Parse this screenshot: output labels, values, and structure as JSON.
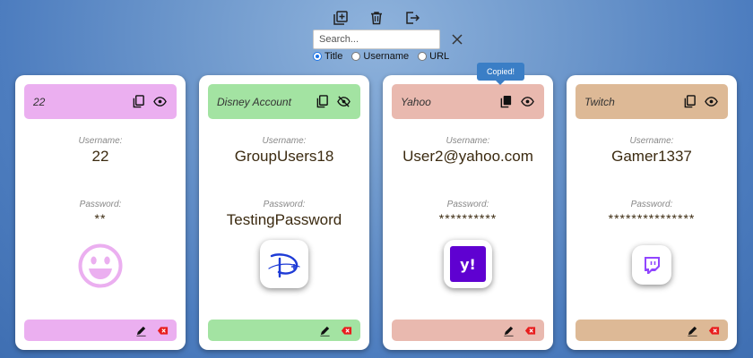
{
  "toolbar": {
    "icons": [
      "add-entry-icon",
      "delete-icon",
      "logout-icon"
    ]
  },
  "search": {
    "placeholder": "Search...",
    "value": ""
  },
  "filter": {
    "options": [
      "Title",
      "Username",
      "URL"
    ],
    "selected": "Title"
  },
  "labels": {
    "username": "Username:",
    "password": "Password:"
  },
  "tooltip": "Copied!",
  "colors": {
    "card1": "#ebaff0",
    "card2": "#a3e3a2",
    "card3": "#e9b9af",
    "card4": "#ddb996"
  },
  "cards": [
    {
      "title": "22",
      "username": "22",
      "password": "**",
      "password_visible": false,
      "logo": "smiley-icon"
    },
    {
      "title": "Disney Account",
      "username": "GroupUsers18",
      "password": "TestingPassword",
      "password_visible": true,
      "logo": "disney-logo"
    },
    {
      "title": "Yahoo",
      "username": "User2@yahoo.com",
      "password": "**********",
      "password_visible": false,
      "logo": "yahoo-logo"
    },
    {
      "title": "Twitch",
      "username": "Gamer1337",
      "password": "***************",
      "password_visible": false,
      "logo": "twitch-logo"
    }
  ]
}
